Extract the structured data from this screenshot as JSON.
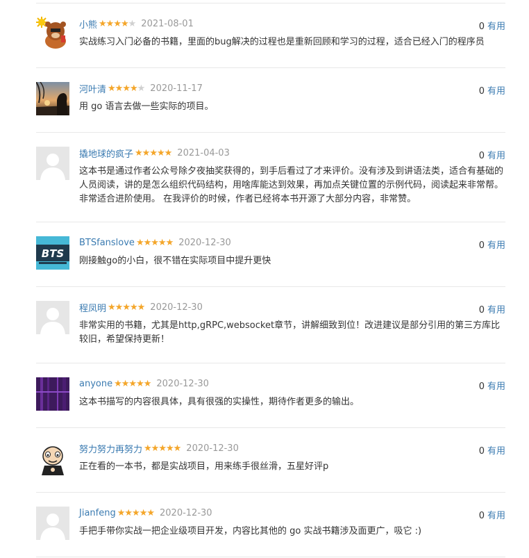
{
  "reviews": [
    {
      "name": "小熊",
      "rating": 4,
      "date": "2021-08-01",
      "text": "实战练习入门必备的书籍，里面的bug解决的过程也是重新回顾和学习的过程，适合已经入门的程序员",
      "useful_count": "0",
      "useful_label": "有用",
      "avatar": "bear-avatar"
    },
    {
      "name": "河叶清",
      "rating": 4,
      "date": "2020-11-17",
      "text": "用 go 语言去做一些实际的项目。",
      "useful_count": "0",
      "useful_label": "有用",
      "avatar": "sunset-avatar"
    },
    {
      "name": "撬地球的疯子",
      "rating": 5,
      "date": "2021-04-03",
      "text": "这本书是通过作者公众号除夕夜抽奖获得的，到手后看过了才来评价。没有涉及到讲语法类，适合有基础的人员阅读，讲的是怎么组织代码结构，用啥库能达到效果，再加点关键位置的示例代码，阅读起来非常帮。非常适合进阶使用。 在我评价的时候，作者已经将本书开源了大部分内容，非常赞。",
      "useful_count": "0",
      "useful_label": "有用",
      "avatar": "default-avatar"
    },
    {
      "name": "BTSfanslove",
      "rating": 5,
      "date": "2020-12-30",
      "text": "刚接触go的小白，很不错在实际项目中提升更快",
      "useful_count": "0",
      "useful_label": "有用",
      "avatar": "bts-avatar",
      "avatar_text": "BTS"
    },
    {
      "name": "程凤明",
      "rating": 5,
      "date": "2020-12-30",
      "text": "非常实用的书籍，尤其是http,gRPC,websocket章节，讲解细致到位！改进建议是部分引用的第三方库比较旧，希望保持更新！",
      "useful_count": "0",
      "useful_label": "有用",
      "avatar": "default-avatar"
    },
    {
      "name": "anyone",
      "rating": 5,
      "date": "2020-12-30",
      "text": "这本书描写的内容很具体，具有很强的实操性，期待作者更多的输出。",
      "useful_count": "0",
      "useful_label": "有用",
      "avatar": "purple-avatar"
    },
    {
      "name": "努力努力再努力",
      "rating": 5,
      "date": "2020-12-30",
      "text": "正在看的一本书，都是实战项目，用来练手很丝滑，五星好评p",
      "useful_count": "0",
      "useful_label": "有用",
      "avatar": "cartoon-avatar"
    },
    {
      "name": "Jianfeng",
      "rating": 5,
      "date": "2020-12-30",
      "text": "手把手带你实战一把企业级项目开发，内容比其他的 go 实战书籍涉及面更广，吸它 :)",
      "useful_count": "0",
      "useful_label": "有用",
      "avatar": "default-avatar"
    }
  ],
  "colors": {
    "link": "#3b7bb1",
    "star": "#f4a62a",
    "star_empty": "#d0d0d0",
    "date": "#999999",
    "divider": "#e8e8e8"
  }
}
